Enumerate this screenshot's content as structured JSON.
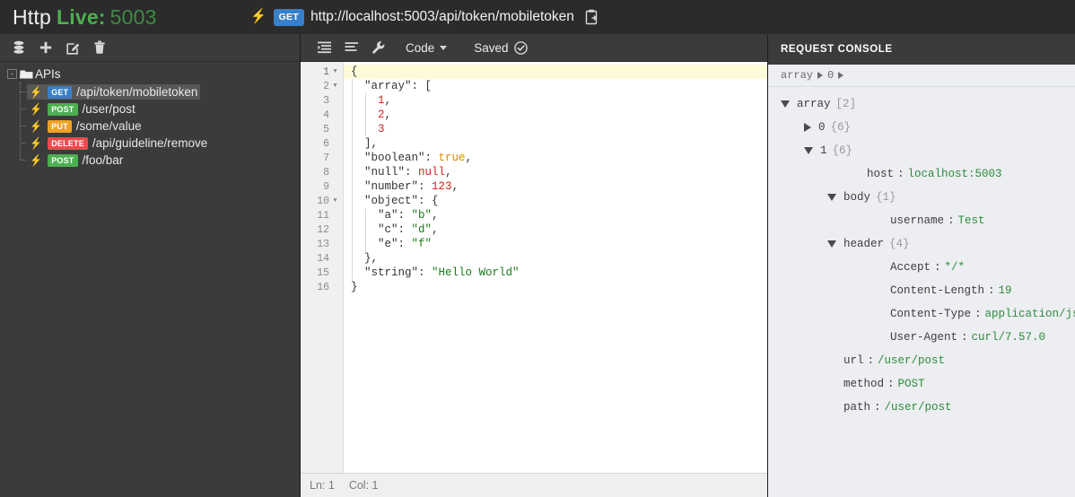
{
  "titlebar": {
    "brand_http": "Http",
    "brand_live": "Live:",
    "brand_port": "5003",
    "bolt_icon": "bolt-icon",
    "method": "GET",
    "method_color": "#3880c9",
    "url": "http://localhost:5003/api/token/mobiletoken",
    "copy_icon": "copy-to-clipboard-icon"
  },
  "sidebar": {
    "toolbar": [
      {
        "icon": "database-icon",
        "label": "Database"
      },
      {
        "icon": "plus-icon",
        "label": "Add"
      },
      {
        "icon": "edit-icon",
        "label": "Edit"
      },
      {
        "icon": "trash-icon",
        "label": "Delete"
      }
    ],
    "root": {
      "label": "APIs",
      "expander": "-",
      "icon": "folder-icon"
    },
    "items": [
      {
        "method": "GET",
        "color": "#3880c9",
        "path": "/api/token/mobiletoken",
        "selected": true
      },
      {
        "method": "POST",
        "color": "#4caf50",
        "path": "/user/post",
        "selected": false
      },
      {
        "method": "PUT",
        "color": "#f0a224",
        "path": "/some/value",
        "selected": false
      },
      {
        "method": "DELETE",
        "color": "#e84c4c",
        "path": "/api/guideline/remove",
        "selected": false
      },
      {
        "method": "POST",
        "color": "#4caf50",
        "path": "/foo/bar",
        "selected": false
      }
    ]
  },
  "editor": {
    "toolbar": {
      "format_icon": "format-indent-icon",
      "wrap_icon": "align-lines-icon",
      "settings_icon": "wrench-icon",
      "mode_label": "Code",
      "mode_caret": "chevron-down-icon",
      "saved_label": "Saved",
      "saved_icon": "check-circle-icon"
    },
    "lines": [
      {
        "n": "1",
        "fold": "open",
        "indent": 0,
        "tokens": [
          {
            "t": "{",
            "c": "punc"
          }
        ]
      },
      {
        "n": "2",
        "fold": "open",
        "indent": 1,
        "tokens": [
          {
            "t": "\"array\"",
            "c": "key"
          },
          {
            "t": ": ",
            "c": "punc"
          },
          {
            "t": "[",
            "c": "punc"
          }
        ]
      },
      {
        "n": "3",
        "fold": "",
        "indent": 2,
        "tokens": [
          {
            "t": "1",
            "c": "num"
          },
          {
            "t": ",",
            "c": "punc"
          }
        ]
      },
      {
        "n": "4",
        "fold": "",
        "indent": 2,
        "tokens": [
          {
            "t": "2",
            "c": "num"
          },
          {
            "t": ",",
            "c": "punc"
          }
        ]
      },
      {
        "n": "5",
        "fold": "",
        "indent": 2,
        "tokens": [
          {
            "t": "3",
            "c": "num"
          }
        ]
      },
      {
        "n": "6",
        "fold": "",
        "indent": 1,
        "tokens": [
          {
            "t": "],",
            "c": "punc"
          }
        ]
      },
      {
        "n": "7",
        "fold": "",
        "indent": 1,
        "tokens": [
          {
            "t": "\"boolean\"",
            "c": "key"
          },
          {
            "t": ": ",
            "c": "punc"
          },
          {
            "t": "true",
            "c": "bool"
          },
          {
            "t": ",",
            "c": "punc"
          }
        ]
      },
      {
        "n": "8",
        "fold": "",
        "indent": 1,
        "tokens": [
          {
            "t": "\"null\"",
            "c": "key"
          },
          {
            "t": ": ",
            "c": "punc"
          },
          {
            "t": "null",
            "c": "null"
          },
          {
            "t": ",",
            "c": "punc"
          }
        ]
      },
      {
        "n": "9",
        "fold": "",
        "indent": 1,
        "tokens": [
          {
            "t": "\"number\"",
            "c": "key"
          },
          {
            "t": ": ",
            "c": "punc"
          },
          {
            "t": "123",
            "c": "num"
          },
          {
            "t": ",",
            "c": "punc"
          }
        ]
      },
      {
        "n": "10",
        "fold": "open",
        "indent": 1,
        "tokens": [
          {
            "t": "\"object\"",
            "c": "key"
          },
          {
            "t": ": ",
            "c": "punc"
          },
          {
            "t": "{",
            "c": "punc"
          }
        ]
      },
      {
        "n": "11",
        "fold": "",
        "indent": 2,
        "tokens": [
          {
            "t": "\"a\"",
            "c": "key"
          },
          {
            "t": ": ",
            "c": "punc"
          },
          {
            "t": "\"b\"",
            "c": "str"
          },
          {
            "t": ",",
            "c": "punc"
          }
        ]
      },
      {
        "n": "12",
        "fold": "",
        "indent": 2,
        "tokens": [
          {
            "t": "\"c\"",
            "c": "key"
          },
          {
            "t": ": ",
            "c": "punc"
          },
          {
            "t": "\"d\"",
            "c": "str"
          },
          {
            "t": ",",
            "c": "punc"
          }
        ]
      },
      {
        "n": "13",
        "fold": "",
        "indent": 2,
        "tokens": [
          {
            "t": "\"e\"",
            "c": "key"
          },
          {
            "t": ": ",
            "c": "punc"
          },
          {
            "t": "\"f\"",
            "c": "str"
          }
        ]
      },
      {
        "n": "14",
        "fold": "",
        "indent": 1,
        "tokens": [
          {
            "t": "},",
            "c": "punc"
          }
        ]
      },
      {
        "n": "15",
        "fold": "",
        "indent": 1,
        "tokens": [
          {
            "t": "\"string\"",
            "c": "key"
          },
          {
            "t": ": ",
            "c": "punc"
          },
          {
            "t": "\"Hello World\"",
            "c": "str"
          }
        ]
      },
      {
        "n": "16",
        "fold": "",
        "indent": 0,
        "tokens": [
          {
            "t": "}",
            "c": "punc"
          }
        ]
      }
    ],
    "statusbar": {
      "line": "Ln: 1",
      "col": "Col: 1"
    }
  },
  "console": {
    "title": "REQUEST CONSOLE",
    "breadcrumb": [
      "array",
      "0"
    ],
    "rows": [
      {
        "depth": 0,
        "tri": "open",
        "key": "array",
        "count": "[2]",
        "value": null
      },
      {
        "depth": 1,
        "tri": "closed",
        "key": "0",
        "count": "{6}",
        "value": null
      },
      {
        "depth": 1,
        "tri": "open",
        "key": "1",
        "count": "{6}",
        "value": null
      },
      {
        "depth": 3,
        "tri": "none",
        "key": "host",
        "count": null,
        "value": "localhost:5003"
      },
      {
        "depth": 2,
        "tri": "open",
        "key": "body",
        "count": "{1}",
        "value": null
      },
      {
        "depth": 4,
        "tri": "none",
        "key": "username",
        "count": null,
        "value": "Test"
      },
      {
        "depth": 2,
        "tri": "open",
        "key": "header",
        "count": "{4}",
        "value": null
      },
      {
        "depth": 4,
        "tri": "none",
        "key": "Accept",
        "count": null,
        "value": "*/*"
      },
      {
        "depth": 4,
        "tri": "none",
        "key": "Content-Length",
        "count": null,
        "value": "19"
      },
      {
        "depth": 4,
        "tri": "none",
        "key": "Content-Type",
        "count": null,
        "value": "application/json"
      },
      {
        "depth": 4,
        "tri": "none",
        "key": "User-Agent",
        "count": null,
        "value": "curl/7.57.0"
      },
      {
        "depth": 2,
        "tri": "none",
        "key": "url",
        "count": null,
        "value": "/user/post"
      },
      {
        "depth": 2,
        "tri": "none",
        "key": "method",
        "count": null,
        "value": "POST"
      },
      {
        "depth": 2,
        "tri": "none",
        "key": "path",
        "count": null,
        "value": "/user/post"
      }
    ]
  }
}
